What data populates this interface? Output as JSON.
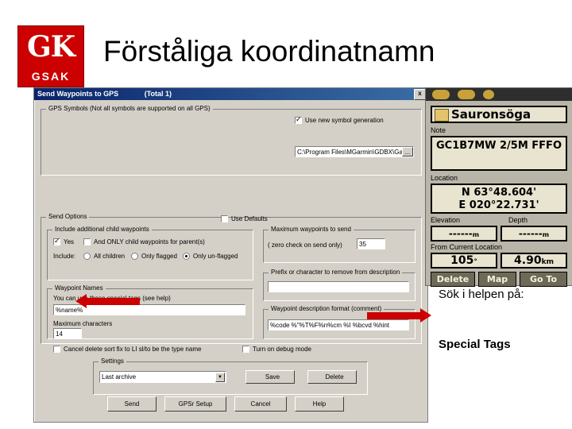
{
  "slide": {
    "title": "Förståliga koordinatnamn",
    "logo": {
      "mark": "GK",
      "name": "GSAK"
    },
    "notes": {
      "line1": "Sök i helpen på:",
      "line2": "Special Tags"
    }
  },
  "dialog": {
    "titlebar": {
      "title": "Send Waypoints to GPS",
      "count": "(Total   1)",
      "close": "x"
    },
    "group_gps": {
      "legend": "GPS Symbols (Not all symbols are supported on all GPS)",
      "checkbox_label": "Use new symbol generation",
      "checkbox_checked": true,
      "path_value": "C:\\Program Files\\MGarmin\\GDBX\\GarminGemMan",
      "path_button": "..."
    },
    "group_send": {
      "legend": "Send Options",
      "use_defaults_label": "Use Defaults",
      "use_defaults_checked": false
    },
    "group_include": {
      "legend": "Include additional child waypoints",
      "yes_label": "Yes",
      "yes_checked": true,
      "only_child_label": "And ONLY child waypoints for parent(s)",
      "only_child_checked": false,
      "include_label": "Include:",
      "radio_all": "All children",
      "radio_only_flagged": "Only flagged",
      "radio_only_unflagged": "Only un-flagged",
      "radio_selected": "Only un-flagged"
    },
    "group_max": {
      "legend": "Maximum waypoints to send",
      "label": "( zero check on send only)",
      "value": "35"
    },
    "group_name": {
      "legend": "Waypoint Names",
      "label": "You can use these special tags (see help)",
      "value": "%name%",
      "max_chars_label": "Maximum characters",
      "max_chars_value": "14"
    },
    "group_desc": {
      "legend": "Prefix or character to remove from description",
      "value": ""
    },
    "group_wpdesc": {
      "legend": "Waypoint description format (comment)",
      "value": "%code %\"%T%F%n%cm %I %bcvd %hint"
    },
    "checkbox_local": {
      "label": "Cancel delete sort fix to LI sl/to be the type name",
      "checked": false
    },
    "checkbox_debug": {
      "label": "Turn on debug mode",
      "checked": false
    },
    "group_settings": {
      "legend": "Settings",
      "dropdown_value": "Last archive",
      "save_label": "Save",
      "delete_label": "Delete"
    },
    "buttons": {
      "send": "Send",
      "gpsr_setup": "GPSr Setup",
      "cancel": "Cancel",
      "help": "Help"
    }
  },
  "gps_panel": {
    "name": "Sauronsöga",
    "note_label": "Note",
    "note_value": "GC1B7MW 2/5M FFFO",
    "location_label": "Location",
    "location_lat": "N  63°48.604'",
    "location_lon": "E 020°22.731'",
    "elevation_label": "Elevation",
    "depth_label": "Depth",
    "elevation_value": "------",
    "elevation_unit": "m",
    "depth_value": "------",
    "depth_unit": "m",
    "from_label": "From Current Location",
    "bearing_value": "105",
    "bearing_unit": "°",
    "distance_value": "4.90",
    "distance_unit": "km",
    "buttons": {
      "delete": "Delete",
      "map": "Map",
      "goto": "Go To"
    }
  }
}
